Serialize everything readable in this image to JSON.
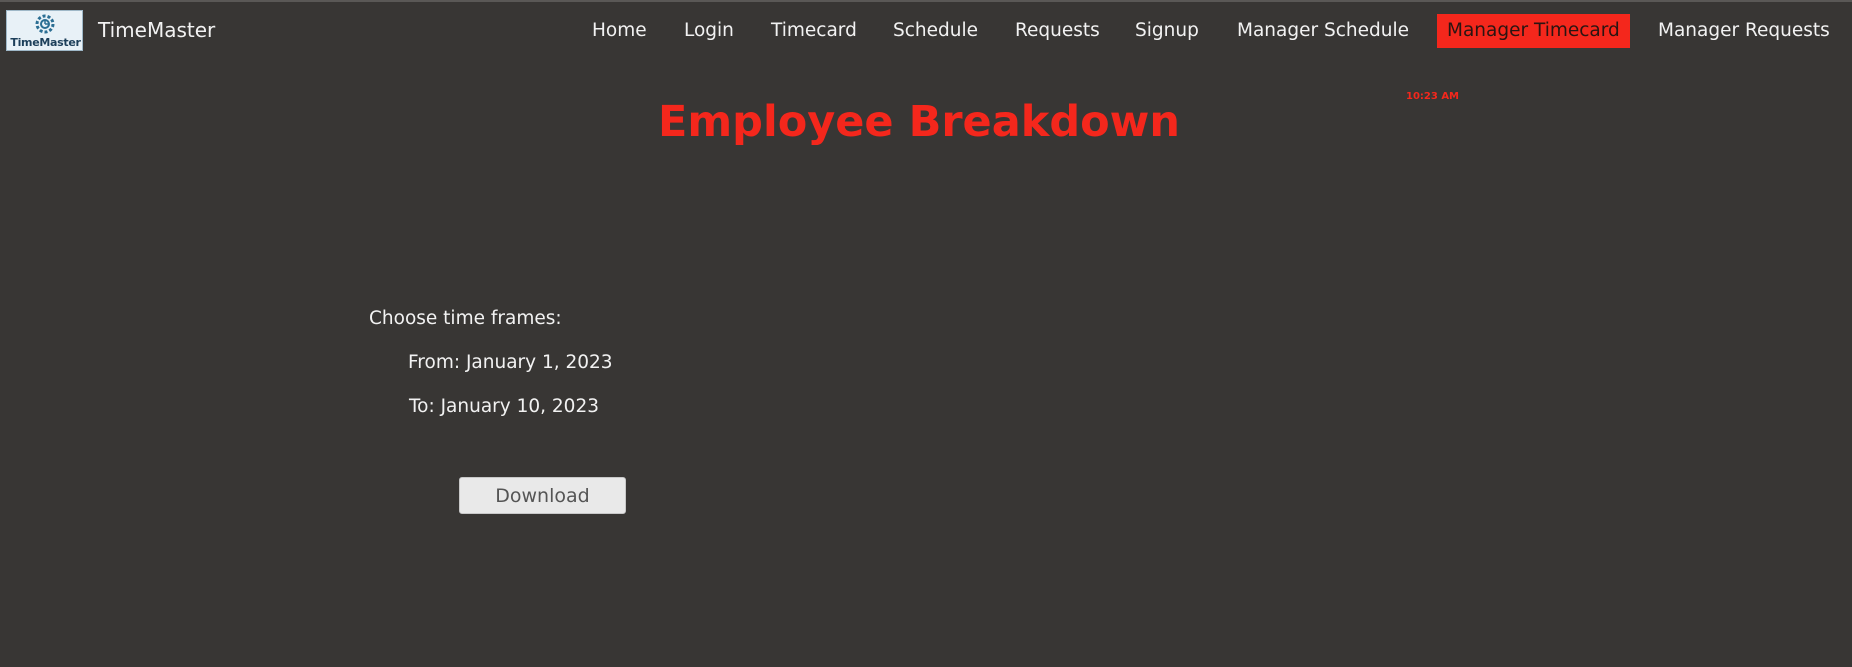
{
  "app": {
    "logo_text": "TimeMaster",
    "brand_name": "TimeMaster"
  },
  "nav": {
    "items": [
      {
        "label": "Home"
      },
      {
        "label": "Login"
      },
      {
        "label": "Timecard"
      },
      {
        "label": "Schedule"
      },
      {
        "label": "Requests"
      },
      {
        "label": "Signup"
      },
      {
        "label": "Manager Schedule"
      },
      {
        "label": "Manager Timecard",
        "active": true
      },
      {
        "label": "Manager Requests"
      }
    ]
  },
  "header": {
    "clock": "10:23 AM",
    "title": "Employee Breakdown"
  },
  "timeframe": {
    "prompt": "Choose time frames:",
    "from_label": "From: January 1, 2023",
    "to_label": "To: January 10, 2023"
  },
  "actions": {
    "download_label": "Download"
  },
  "colors": {
    "background": "#383634",
    "accent": "#f4271c",
    "text": "#f2f2f2",
    "button": "#e9e9e9"
  }
}
